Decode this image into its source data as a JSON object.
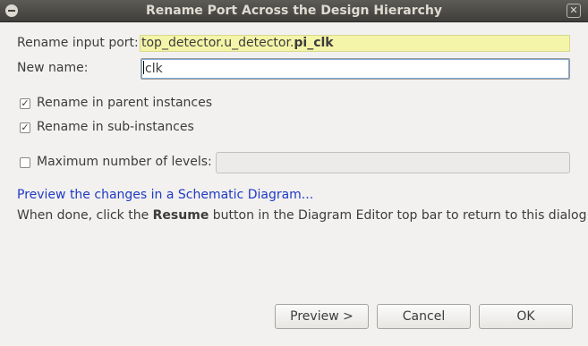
{
  "window": {
    "title": "Rename Port Across the Design Hierarchy",
    "close_glyph": "✕"
  },
  "form": {
    "rename_input_label": "Rename input port:",
    "port_prefix": "top_detector.u_detector.",
    "port_name": "pi_clk",
    "new_name_label": "New name:",
    "new_name_value": "clk",
    "rename_parent_label": "Rename in parent instances",
    "rename_parent_checked": true,
    "rename_sub_label": "Rename in sub-instances",
    "rename_sub_checked": true,
    "max_levels_label": "Maximum number of levels:",
    "max_levels_checked": false,
    "max_levels_value": ""
  },
  "preview_link": "Preview the changes in a Schematic Diagram...",
  "help": {
    "before": "When done, click the ",
    "bold": "Resume",
    "after": " button in the Diagram Editor top bar to return to this dialog."
  },
  "buttons": {
    "preview": "Preview >",
    "cancel": "Cancel",
    "ok": "OK"
  },
  "colors": {
    "accent_link": "#1f3ac4",
    "readonly_field": "#f5f5a9",
    "titlebar": "#3f3e3a"
  }
}
